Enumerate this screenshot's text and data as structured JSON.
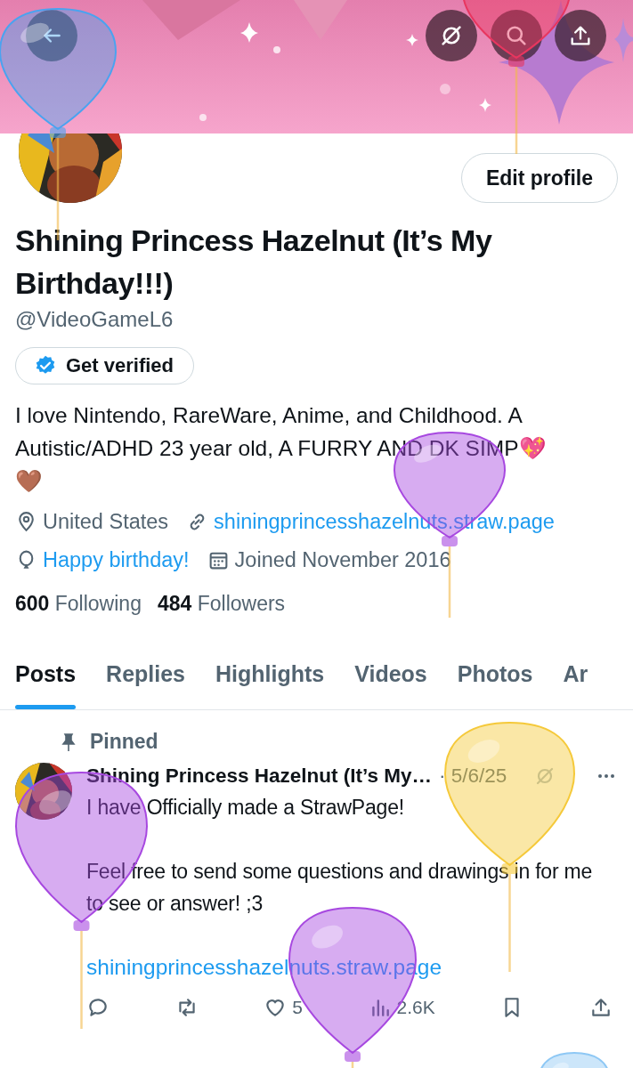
{
  "profile": {
    "edit_button": "Edit profile",
    "name": "Shining Princess Hazelnut (It’s My Birthday!!!)",
    "handle": "@VideoGameL6",
    "verify_button": "Get verified",
    "bio": "I love Nintendo, RareWare, Anime, and Childhood. A Autistic/ADHD 23 year old, A FURRY AND DK SIMP💖 🤎",
    "location": "United States",
    "website": "shiningprincesshazelnuts.straw.page",
    "birthday": "Happy birthday!",
    "joined": "Joined November 2016",
    "following_count": "600",
    "following_label": "Following",
    "followers_count": "484",
    "followers_label": "Followers"
  },
  "tabs": [
    {
      "label": "Posts",
      "selected": true
    },
    {
      "label": "Replies",
      "selected": false
    },
    {
      "label": "Highlights",
      "selected": false
    },
    {
      "label": "Videos",
      "selected": false
    },
    {
      "label": "Photos",
      "selected": false
    },
    {
      "label": "Ar",
      "selected": false
    }
  ],
  "pinned_post": {
    "pinned_label": "Pinned",
    "author": "Shining Princess Hazelnut (It’s My…",
    "date": "· 5/6/25",
    "paragraphs": [
      "I have Officially made a StrawPage!",
      "Feel free to send some questions and drawings in for me to see or answer! ;3"
    ],
    "link": "shiningprincesshazelnuts.straw.page",
    "likes": "5",
    "views": "2.6K"
  },
  "balloons": [
    {
      "color": "#4aa3f0"
    },
    {
      "color": "#e8365f"
    },
    {
      "color": "#a748e0"
    },
    {
      "color": "#a748e0"
    },
    {
      "color": "#f5c93a"
    },
    {
      "color": "#a748e0"
    },
    {
      "color": "#8ec8f5"
    }
  ]
}
